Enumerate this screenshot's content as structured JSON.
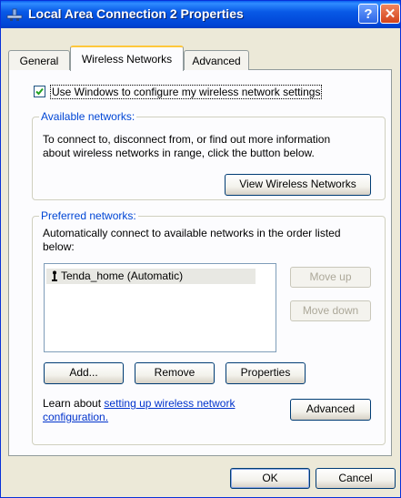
{
  "window": {
    "title": "Local Area Connection 2 Properties",
    "help_label": "?",
    "close_label": "✕"
  },
  "tabs": [
    {
      "label": "General",
      "active": false
    },
    {
      "label": "Wireless Networks",
      "active": true
    },
    {
      "label": "Advanced",
      "active": false
    }
  ],
  "use_windows_checkbox": {
    "label": "Use Windows to configure my wireless network settings",
    "checked": true
  },
  "available_networks": {
    "legend": "Available networks:",
    "description_line1": "To connect to, disconnect from, or find out more information",
    "description_line2": "about wireless networks in range, click the button below.",
    "view_button": "View Wireless Networks"
  },
  "preferred_networks": {
    "legend": "Preferred networks:",
    "description_line1": "Automatically connect to available networks in the order listed",
    "description_line2": "below:",
    "items": [
      "Tenda_home (Automatic)"
    ],
    "move_up": "Move up",
    "move_down": "Move down",
    "add": "Add...",
    "remove": "Remove",
    "properties": "Properties",
    "learn_prefix": "Learn about ",
    "learn_link_line1": "setting up wireless network",
    "learn_link_line2": "configuration.",
    "advanced": "Advanced"
  },
  "footer": {
    "ok": "OK",
    "cancel": "Cancel"
  },
  "colors": {
    "titlebar": "#0054e3",
    "dialog_bg": "#ece9d8",
    "groupbox_legend": "#0046d5",
    "link": "#0033cc",
    "active_tab_accent": "#ffc83c"
  }
}
